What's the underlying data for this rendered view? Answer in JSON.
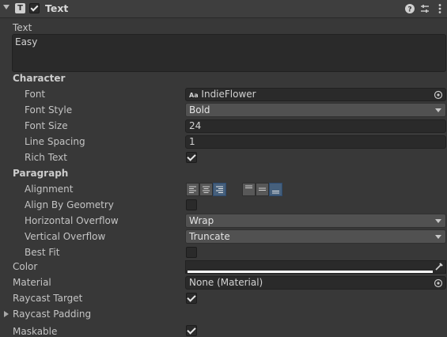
{
  "header": {
    "title": "Text",
    "component_icon": "T",
    "icons": [
      "help-icon",
      "presets-icon",
      "more-options-icon"
    ]
  },
  "text_field": {
    "label": "Text",
    "value": "Easy"
  },
  "character": {
    "header": "Character",
    "font": {
      "label": "Font",
      "value": "IndieFlower",
      "prefix_icon": "Aa"
    },
    "font_style": {
      "label": "Font Style",
      "value": "Bold"
    },
    "font_size": {
      "label": "Font Size",
      "value": "24"
    },
    "line_spacing": {
      "label": "Line Spacing",
      "value": "1"
    },
    "rich_text": {
      "label": "Rich Text",
      "checked": true
    }
  },
  "paragraph": {
    "header": "Paragraph",
    "alignment": {
      "label": "Alignment",
      "horizontal_selected": "right",
      "vertical_selected": "bottom"
    },
    "align_by_geometry": {
      "label": "Align By Geometry",
      "checked": false
    },
    "horizontal_overflow": {
      "label": "Horizontal Overflow",
      "value": "Wrap"
    },
    "vertical_overflow": {
      "label": "Vertical Overflow",
      "value": "Truncate"
    },
    "best_fit": {
      "label": "Best Fit",
      "checked": false
    }
  },
  "color": {
    "label": "Color",
    "value": "#ffffff"
  },
  "material": {
    "label": "Material",
    "value": "None (Material)"
  },
  "raycast_target": {
    "label": "Raycast Target",
    "checked": true
  },
  "raycast_padding": {
    "label": "Raycast Padding"
  },
  "maskable": {
    "label": "Maskable",
    "checked": true
  },
  "colors": {
    "background": "#383838",
    "field": "#2a2a2a",
    "dropdown": "#515151",
    "selected_button": "#46607c"
  }
}
